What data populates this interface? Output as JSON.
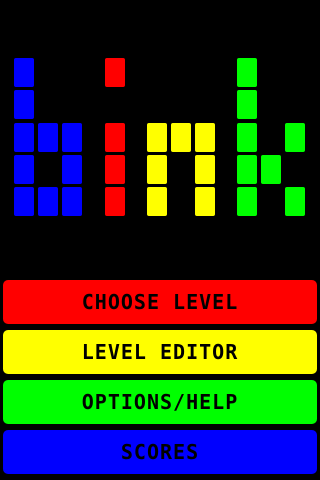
{
  "app": {
    "title": "bink"
  },
  "logo": {
    "letters": [
      {
        "letter": "b",
        "color": "#0000FF"
      },
      {
        "letter": "i",
        "color": "#FF0000"
      },
      {
        "letter": "n",
        "color": "#FFFF00"
      },
      {
        "letter": "k",
        "color": "#00FF00"
      }
    ]
  },
  "menu": {
    "buttons": [
      {
        "label": "CHOOSE LEVEL",
        "color": "#FF0000"
      },
      {
        "label": "LEVEL EDITOR",
        "color": "#FFFF00"
      },
      {
        "label": "OPTIONS/HELP",
        "color": "#00FF00"
      },
      {
        "label": "SCORES",
        "color": "#0000FF"
      }
    ]
  }
}
